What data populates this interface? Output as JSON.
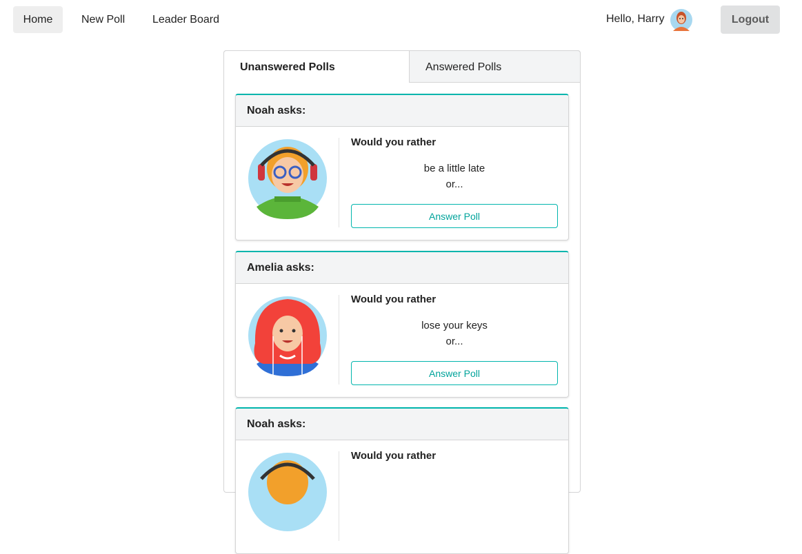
{
  "nav": {
    "home": "Home",
    "new_poll": "New Poll",
    "leader_board": "Leader Board",
    "greeting": "Hello, Harry",
    "logout": "Logout"
  },
  "tabs": {
    "unanswered": "Unanswered Polls",
    "answered": "Answered Polls"
  },
  "polls": [
    {
      "author": "Noah asks:",
      "prompt": "Would you rather",
      "option": "be a little late",
      "or": "or...",
      "button": "Answer Poll",
      "avatar": "boy-with-headphones-avatar"
    },
    {
      "author": "Amelia asks:",
      "prompt": "Would you rather",
      "option": "lose your keys",
      "or": "or...",
      "button": "Answer Poll",
      "avatar": "red-haired-girl-avatar"
    },
    {
      "author": "Noah asks:",
      "prompt": "Would you rather",
      "option": "",
      "or": "",
      "button": "",
      "avatar": "boy-with-headphones-avatar"
    }
  ],
  "colors": {
    "accent": "#00b5ad",
    "header_bg": "#f3f4f5"
  }
}
